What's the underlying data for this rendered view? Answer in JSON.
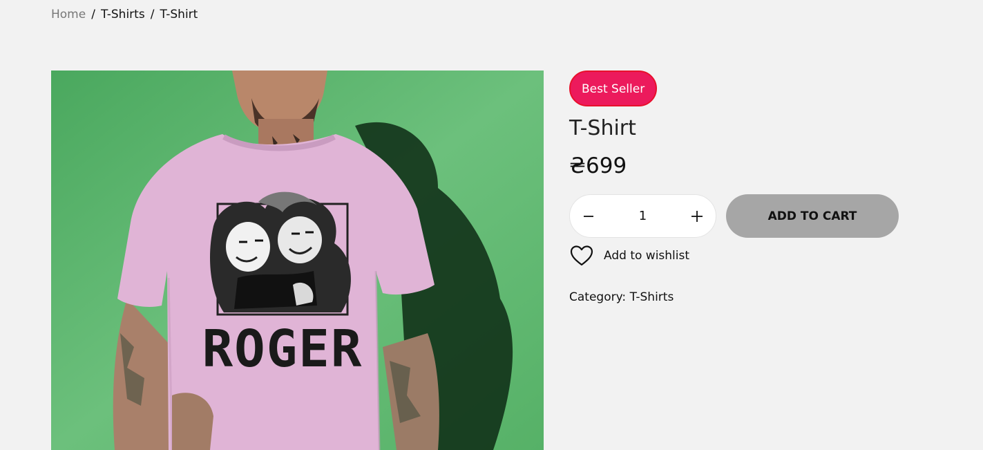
{
  "breadcrumb": {
    "home": "Home",
    "separator": "/",
    "category": "T-Shirts",
    "current": "T-Shirt"
  },
  "product": {
    "badge": "Best Seller",
    "title": "T-Shirt",
    "price": "₴699",
    "image_text": "ROGER",
    "quantity": "1",
    "add_to_cart_label": "ADD TO CART",
    "wishlist_label": "Add to wishlist",
    "category_label": "Category:",
    "category_value": "T-Shirts"
  },
  "icons": {
    "decrease": "minus-icon",
    "increase": "plus-icon",
    "wishlist": "heart-icon"
  },
  "colors": {
    "background": "#f2f2f2",
    "badge_bg": "#ec1a5c",
    "badge_border": "#e8102c",
    "button_bg": "#a6a6a6",
    "image_bg": "#5cb36c",
    "shirt": "#e0b4d6"
  }
}
